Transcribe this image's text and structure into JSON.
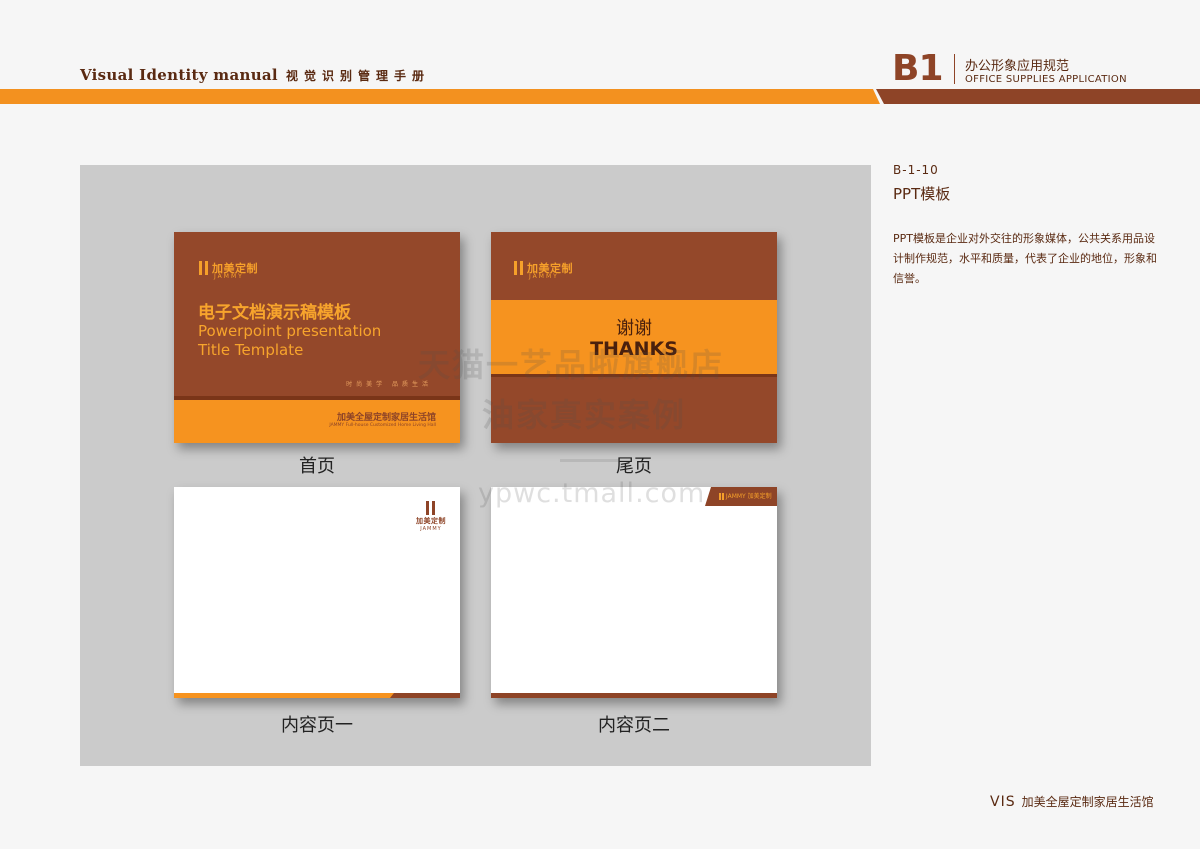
{
  "header": {
    "title_en": "Visual Identity  manual",
    "title_cn": "视觉识别管理手册",
    "section_code": "B1",
    "section_cn": "办公形象应用规范",
    "section_en": "OFFICE SUPPLIES APPLICATION"
  },
  "colors": {
    "brand_brown": "#8e4427",
    "brand_orange": "#f3911f",
    "board_gray": "#cbcbcb"
  },
  "slides": {
    "cover": {
      "caption": "首页",
      "logo_cn": "加美定制",
      "logo_en": "JAMMY",
      "title_cn": "电子文档演示稿模板",
      "title_en_line1": "Powerpoint presentation",
      "title_en_line2": "Title Template",
      "slogan": "时尚美学 品质生活",
      "footer_cn": "加美全屋定制家居生活馆",
      "footer_en": "JAMMY Full-house Customized Home Living Hall"
    },
    "end": {
      "caption": "尾页",
      "logo_cn": "加美定制",
      "logo_en": "JAMMY",
      "thanks_cn": "谢谢",
      "thanks_en": "THANKS"
    },
    "content1": {
      "caption": "内容页一",
      "logo_cn": "加美定制",
      "logo_en": "JAMMY"
    },
    "content2": {
      "caption": "内容页二",
      "tab_logo": "JAMMY 加美定制"
    }
  },
  "side": {
    "code": "B-1-10",
    "title": "PPT模板",
    "description": "PPT模板是企业对外交往的形象媒体，公共关系用品设计制作规范，水平和质量，代表了企业的地位，形象和信誉。"
  },
  "watermark": {
    "line1": "天猫一艺品啦旗舰店",
    "line2": "油家真实案例",
    "line3": "ypwc.tmall.com"
  },
  "footer": {
    "vis": "VIS",
    "company": "加美全屋定制家居生活馆"
  }
}
